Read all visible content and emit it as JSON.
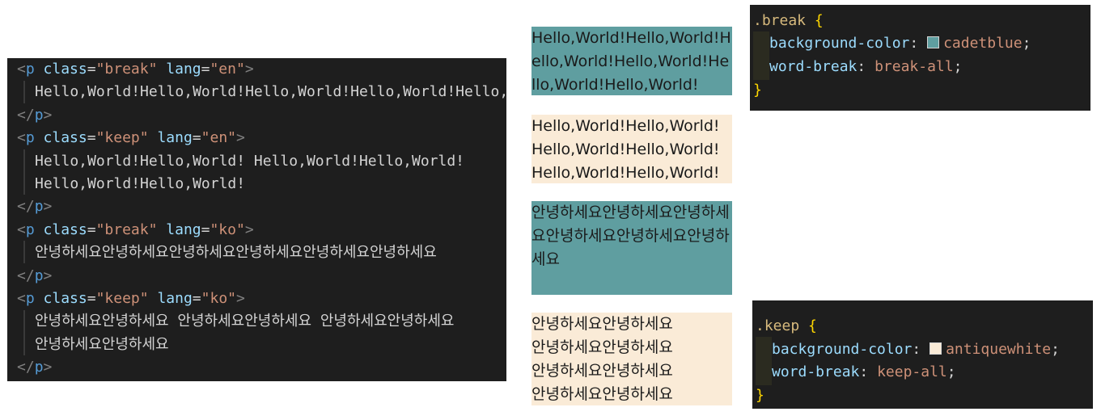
{
  "editor": {
    "lines": [
      {
        "kind": "open",
        "attr_value": "break",
        "lang": "en"
      },
      {
        "kind": "text",
        "text": "Hello,World!Hello,World!Hello,World!Hello,World!Hello,World!"
      },
      {
        "kind": "close"
      },
      {
        "kind": "open",
        "attr_value": "keep",
        "lang": "en"
      },
      {
        "kind": "text",
        "text": "Hello,World!Hello,World! Hello,World!Hello,World!"
      },
      {
        "kind": "text",
        "text": "Hello,World!Hello,World!"
      },
      {
        "kind": "close"
      },
      {
        "kind": "open",
        "attr_value": "break",
        "lang": "ko"
      },
      {
        "kind": "text",
        "text": "안녕하세요안녕하세요안녕하세요안녕하세요안녕하세요안녕하세요"
      },
      {
        "kind": "close"
      },
      {
        "kind": "open",
        "attr_value": "keep",
        "lang": "ko"
      },
      {
        "kind": "text",
        "text": "안녕하세요안녕하세요  안녕하세요안녕하세요  안녕하세요안녕하세요"
      },
      {
        "kind": "text",
        "text": "안녕하세요안녕하세요"
      },
      {
        "kind": "close"
      }
    ],
    "tag_name": "p",
    "attr_class": "class",
    "attr_lang": "lang"
  },
  "css_break": {
    "selector": ".break",
    "open_brace": "{",
    "close_brace": "}",
    "prop1": "background-color",
    "val1": "cadetblue",
    "swatch1": "#5f9ea0",
    "prop2": "word-break",
    "val2": "break-all"
  },
  "css_keep": {
    "selector": ".keep",
    "open_brace": "{",
    "close_brace": "}",
    "prop1": "background-color",
    "val1": "antiquewhite",
    "swatch1": "#faebd7",
    "prop2": "word-break",
    "val2": "keep-all"
  },
  "preview": {
    "break_en": "Hello,World!Hello,World!Hello,World!Hello,World!Hello,World!Hello,World!",
    "keep_en": "Hello,World!Hello,World! Hello,World!Hello,World! Hello,World!Hello,World!",
    "break_ko": "안녕하세요안녕하세요안녕하세요안녕하세요안녕하세요안녕하세요",
    "keep_ko": "안녕하세요안녕하세요 안녕하세요안녕하세요 안녕하세요안녕하세요 안녕하세요안녕하세요"
  }
}
